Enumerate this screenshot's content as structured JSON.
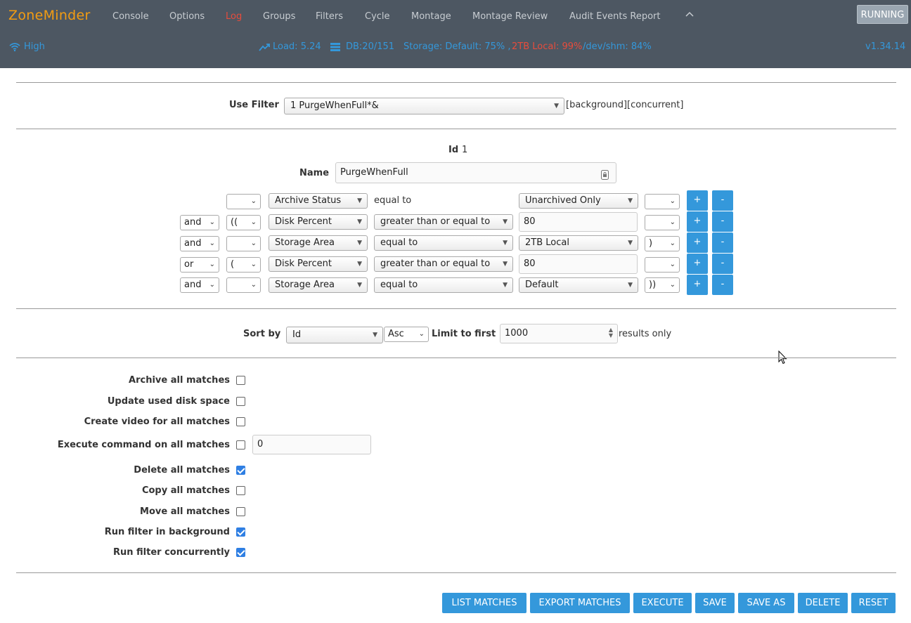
{
  "header": {
    "brand": "ZoneMinder",
    "nav": [
      "Console",
      "Options",
      "Log",
      "Groups",
      "Filters",
      "Cycle",
      "Montage",
      "Montage Review",
      "Audit Events Report"
    ],
    "active_nav": "Log",
    "collapse_icon": "chevron-up-icon",
    "run_state": "RUNNING",
    "bandwidth": "High",
    "load": "Load: 5.24",
    "db": "DB:20/151",
    "storage_prefix": "Storage: Default: 75% ,",
    "storage_local": "2TB Local: 99%",
    "storage_shm": "/dev/shm: 84%",
    "version": "v1.34.14"
  },
  "use_filter": {
    "label": "Use Filter",
    "selected": "1 PurgeWhenFull*&",
    "flags": "[background][concurrent]"
  },
  "filter": {
    "id_label": "Id",
    "id_value": "1",
    "name_label": "Name",
    "name_value": "PurgeWhenFull"
  },
  "terms": [
    {
      "conj": "",
      "obr": "",
      "attr": "Archive Status",
      "op": "equal to",
      "op_static": true,
      "value": "Unarchived Only",
      "value_type": "select",
      "cbr": ""
    },
    {
      "conj": "and",
      "obr": "((",
      "attr": "Disk Percent",
      "op": "greater than or equal to",
      "op_static": false,
      "value": "80",
      "value_type": "input",
      "cbr": ""
    },
    {
      "conj": "and",
      "obr": "",
      "attr": "Storage Area",
      "op": "equal to",
      "op_static": false,
      "value": "2TB Local",
      "value_type": "select",
      "cbr": ")"
    },
    {
      "conj": "or",
      "obr": "(",
      "attr": "Disk Percent",
      "op": "greater than or equal to",
      "op_static": false,
      "value": "80",
      "value_type": "input",
      "cbr": ""
    },
    {
      "conj": "and",
      "obr": "",
      "attr": "Storage Area",
      "op": "equal to",
      "op_static": false,
      "value": "Default",
      "value_type": "select",
      "cbr": "))"
    }
  ],
  "term_buttons": {
    "add": "+",
    "remove": "-"
  },
  "sort": {
    "label": "Sort by",
    "field": "Id",
    "direction": "Asc",
    "limit_label": "Limit to first",
    "limit_value": "1000",
    "limit_suffix": "results only"
  },
  "actions": [
    {
      "label": "Archive all matches",
      "checked": false
    },
    {
      "label": "Update used disk space",
      "checked": false
    },
    {
      "label": "Create video for all matches",
      "checked": false
    },
    {
      "label": "Execute command on all matches",
      "checked": false,
      "input": "0"
    },
    {
      "label": "Delete all matches",
      "checked": true
    },
    {
      "label": "Copy all matches",
      "checked": false
    },
    {
      "label": "Move all matches",
      "checked": false
    },
    {
      "label": "Run filter in background",
      "checked": true
    },
    {
      "label": "Run filter concurrently",
      "checked": true
    }
  ],
  "buttons": [
    "LIST MATCHES",
    "EXPORT MATCHES",
    "EXECUTE",
    "SAVE",
    "SAVE AS",
    "DELETE",
    "RESET"
  ],
  "colors": {
    "topbar": "#4d5762",
    "brand": "#f39c12",
    "accent": "#3498db",
    "danger": "#e74c3c"
  }
}
